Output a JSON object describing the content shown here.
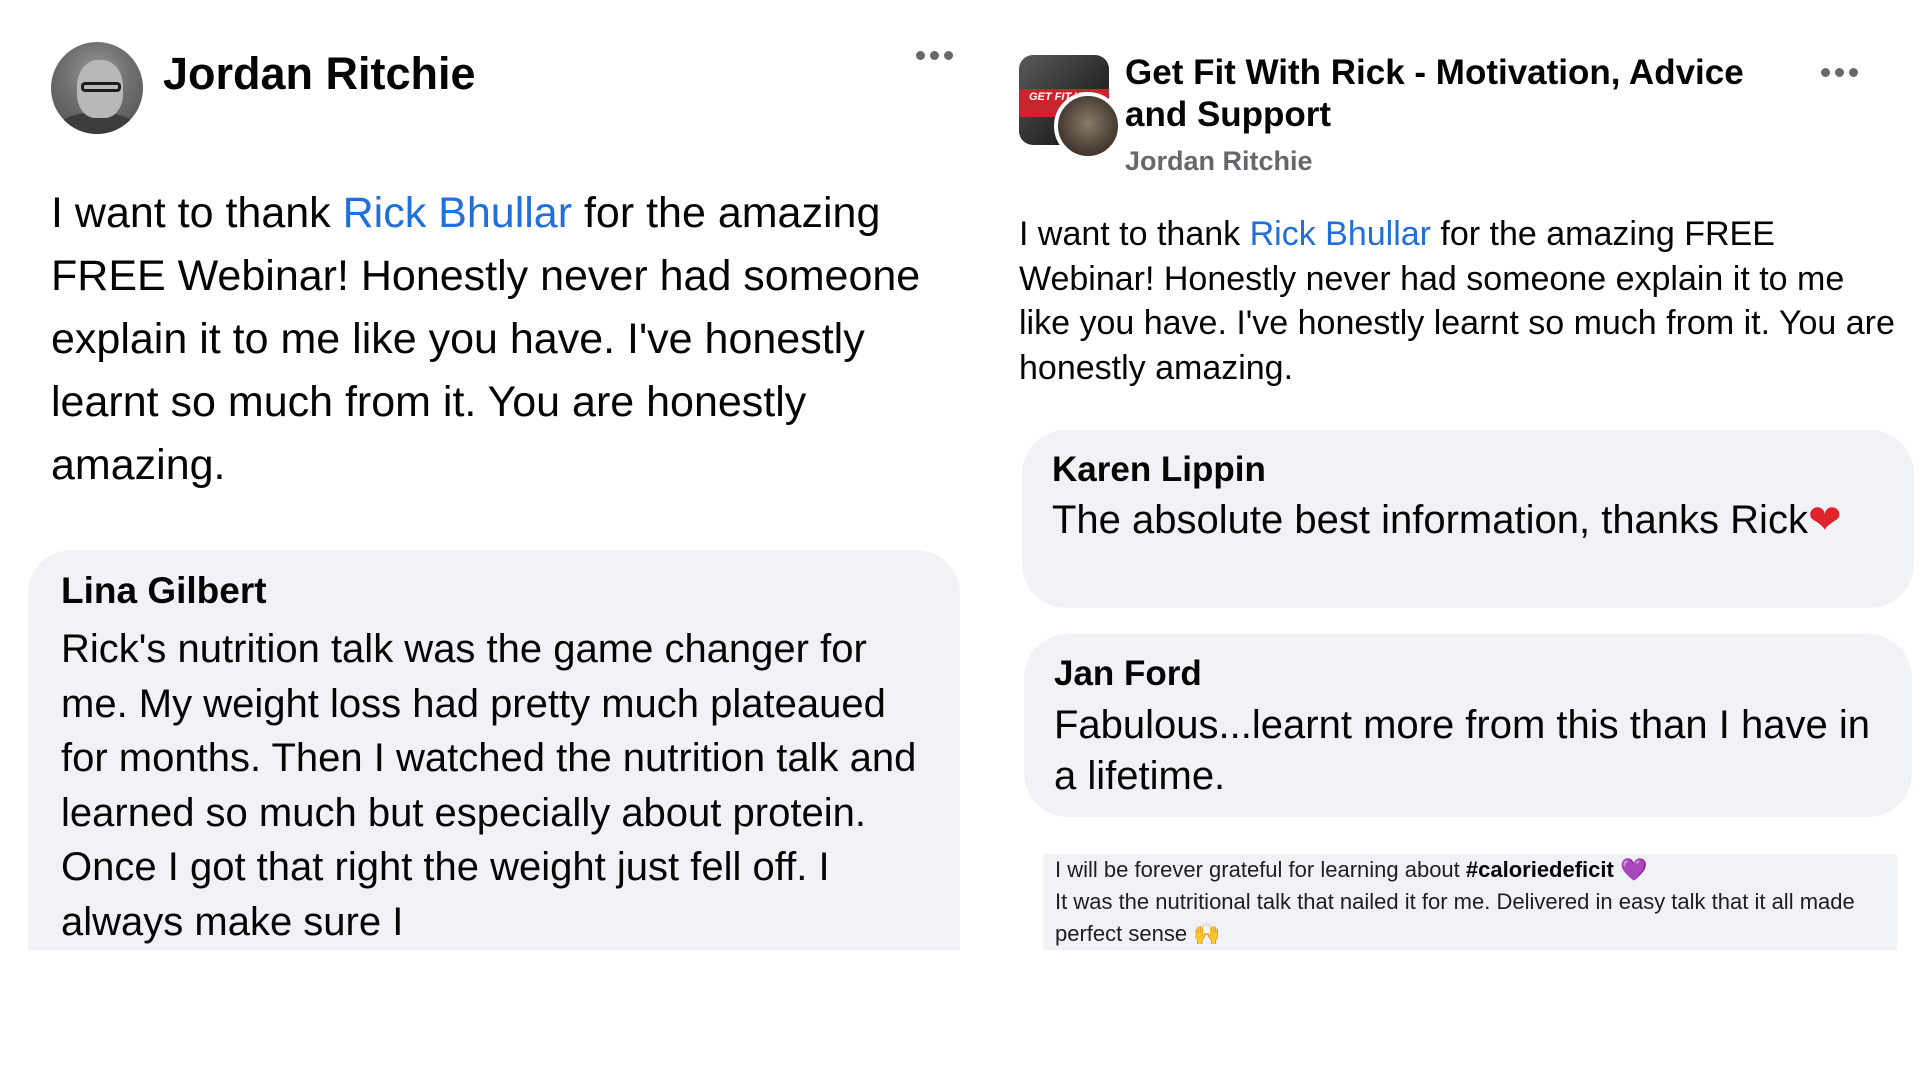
{
  "left_post": {
    "author": "Jordan Ritchie",
    "text_before": "I want to thank ",
    "mention": "Rick Bhullar",
    "text_after": " for the amazing FREE Webinar! Honestly never had someone explain it to me like you have. I've honestly learnt so much from it. You are honestly amazing.",
    "comment": {
      "author": "Lina Gilbert",
      "text": "Rick's nutrition talk was the game changer for me. My weight loss had pretty much plateaued for months. Then I watched the nutrition talk and learned so much but especially about protein. Once I got that right the weight just fell off. I always make sure I"
    }
  },
  "right_post": {
    "group_name": "Get Fit With Rick - Motivation, Advice and Support",
    "group_avatar_label": "GET FIT WI",
    "author": "Jordan Ritchie",
    "text_before": "I want to thank ",
    "mention": "Rick Bhullar",
    "text_after": " for the amazing FREE Webinar! Honestly never had someone explain it to me like you have. I've honestly learnt so much from it. You are honestly amazing.",
    "comments": [
      {
        "author": "Karen Lippin",
        "text": "The absolute best information, thanks Rick",
        "emoji": "❤"
      },
      {
        "author": "Jan Ford",
        "text": "Fabulous...learnt more from this than I have in a lifetime."
      }
    ],
    "note": {
      "before": "I will be forever grateful for learning about ",
      "hashtag": "#caloriedeficit",
      "emoji_heart": "💜",
      "line2": "It was the nutritional talk that nailed it for me. Delivered in easy talk that it all made perfect sense ",
      "emoji_hands": "🙌"
    }
  },
  "icons": {
    "more": "more-options-icon",
    "heart": "red-heart-icon"
  },
  "colors": {
    "mention": "#216fdb",
    "bubble": "#f0f2f5",
    "secondary_text": "#65676b"
  }
}
